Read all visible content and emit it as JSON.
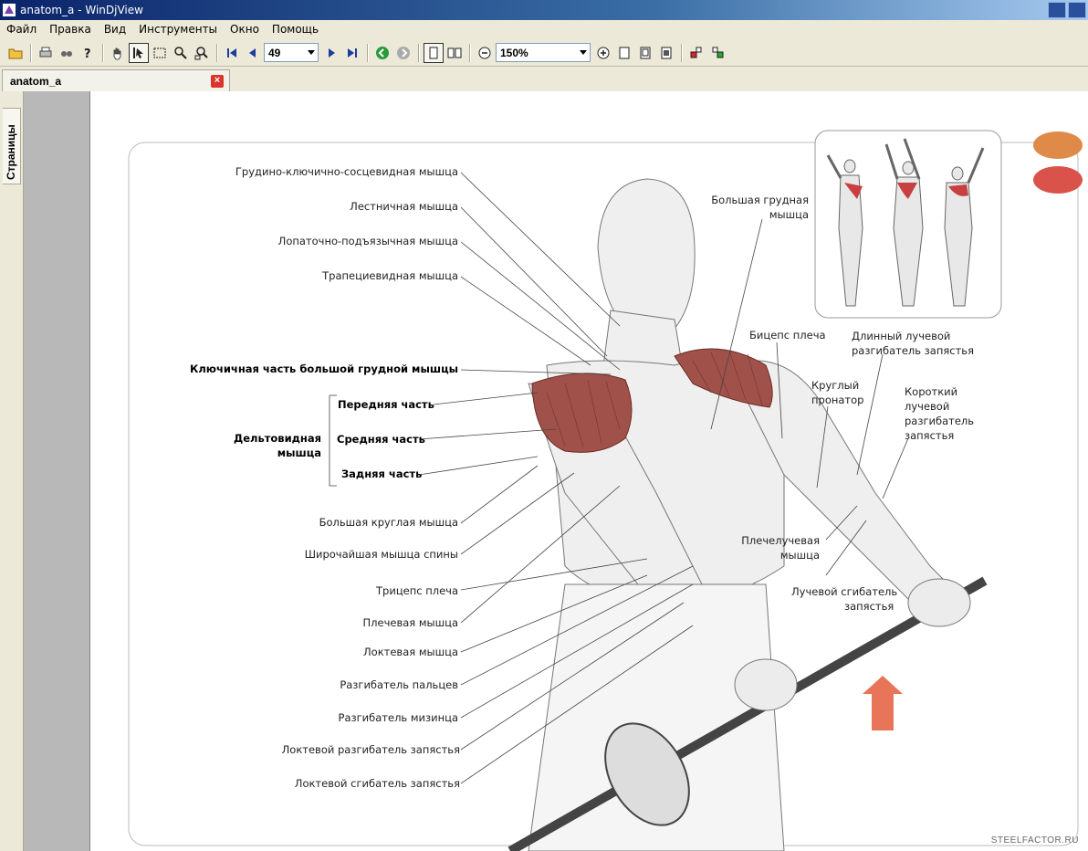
{
  "window": {
    "title": "anatom_a - WinDjView"
  },
  "menu": [
    "Файл",
    "Правка",
    "Вид",
    "Инструменты",
    "Окно",
    "Помощь"
  ],
  "toolbar": {
    "page_number": "49",
    "zoom": "150%",
    "icons": [
      "open-icon",
      "print-icon",
      "find-icon",
      "help-icon",
      "hand-tool-icon",
      "select-tool-icon",
      "rect-select-icon",
      "zoom-in-tool-icon",
      "zoom-rect-icon",
      "first-page-icon",
      "prev-page-icon",
      "next-page-icon",
      "last-page-icon",
      "back-icon",
      "forward-icon",
      "single-page-icon",
      "facing-pages-icon",
      "zoom-out-icon",
      "zoom-in-icon",
      "fit-page-icon",
      "fit-width-icon",
      "actual-size-icon",
      "rotate-left-icon",
      "rotate-right-icon"
    ]
  },
  "tab": {
    "label": "anatom_a"
  },
  "sidebar": {
    "tab_label": "Страницы"
  },
  "figure": {
    "left_labels": [
      "Грудино-ключично-сосцевидная мышца",
      "Лестничная мышца",
      "Лопаточно-подъязычная мышца",
      "Трапециевидная мышца",
      "Ключичная часть большой грудной мышцы",
      "Большая круглая мышца",
      "Широчайшая мышца спины",
      "Трицепс плеча",
      "Плечевая мышца",
      "Локтевая мышца",
      "Разгибатель пальцев",
      "Разгибатель мизинца",
      "Локтевой разгибатель запястья",
      "Локтевой сгибатель запястья"
    ],
    "deltoid": {
      "name_line1": "Дельтовидная",
      "name_line2": "мышца",
      "parts": [
        "Передняя часть",
        "Средняя часть",
        "Задняя часть"
      ]
    },
    "right_labels": {
      "pectoralis": [
        "Большая грудная",
        "мышца"
      ],
      "biceps": "Бицепс плеча",
      "ext_carpi_longus": [
        "Длинный лучевой",
        "разгибатель запястья"
      ],
      "pronator": [
        "Круглый",
        "пронатор"
      ],
      "ext_carpi_brevis": [
        "Короткий",
        "лучевой",
        "разгибатель",
        "запястья"
      ],
      "brachioradialis": [
        "Плечелучевая",
        "мышца"
      ],
      "flexor_carpi_radialis": [
        "Лучевой сгибатель",
        "запястья"
      ]
    },
    "watermark": "STEELFACTOR.RU",
    "colors": {
      "highlight_primary": "#d9534a",
      "highlight_secondary": "#e08a4a",
      "arrow": "#e8745a"
    }
  }
}
